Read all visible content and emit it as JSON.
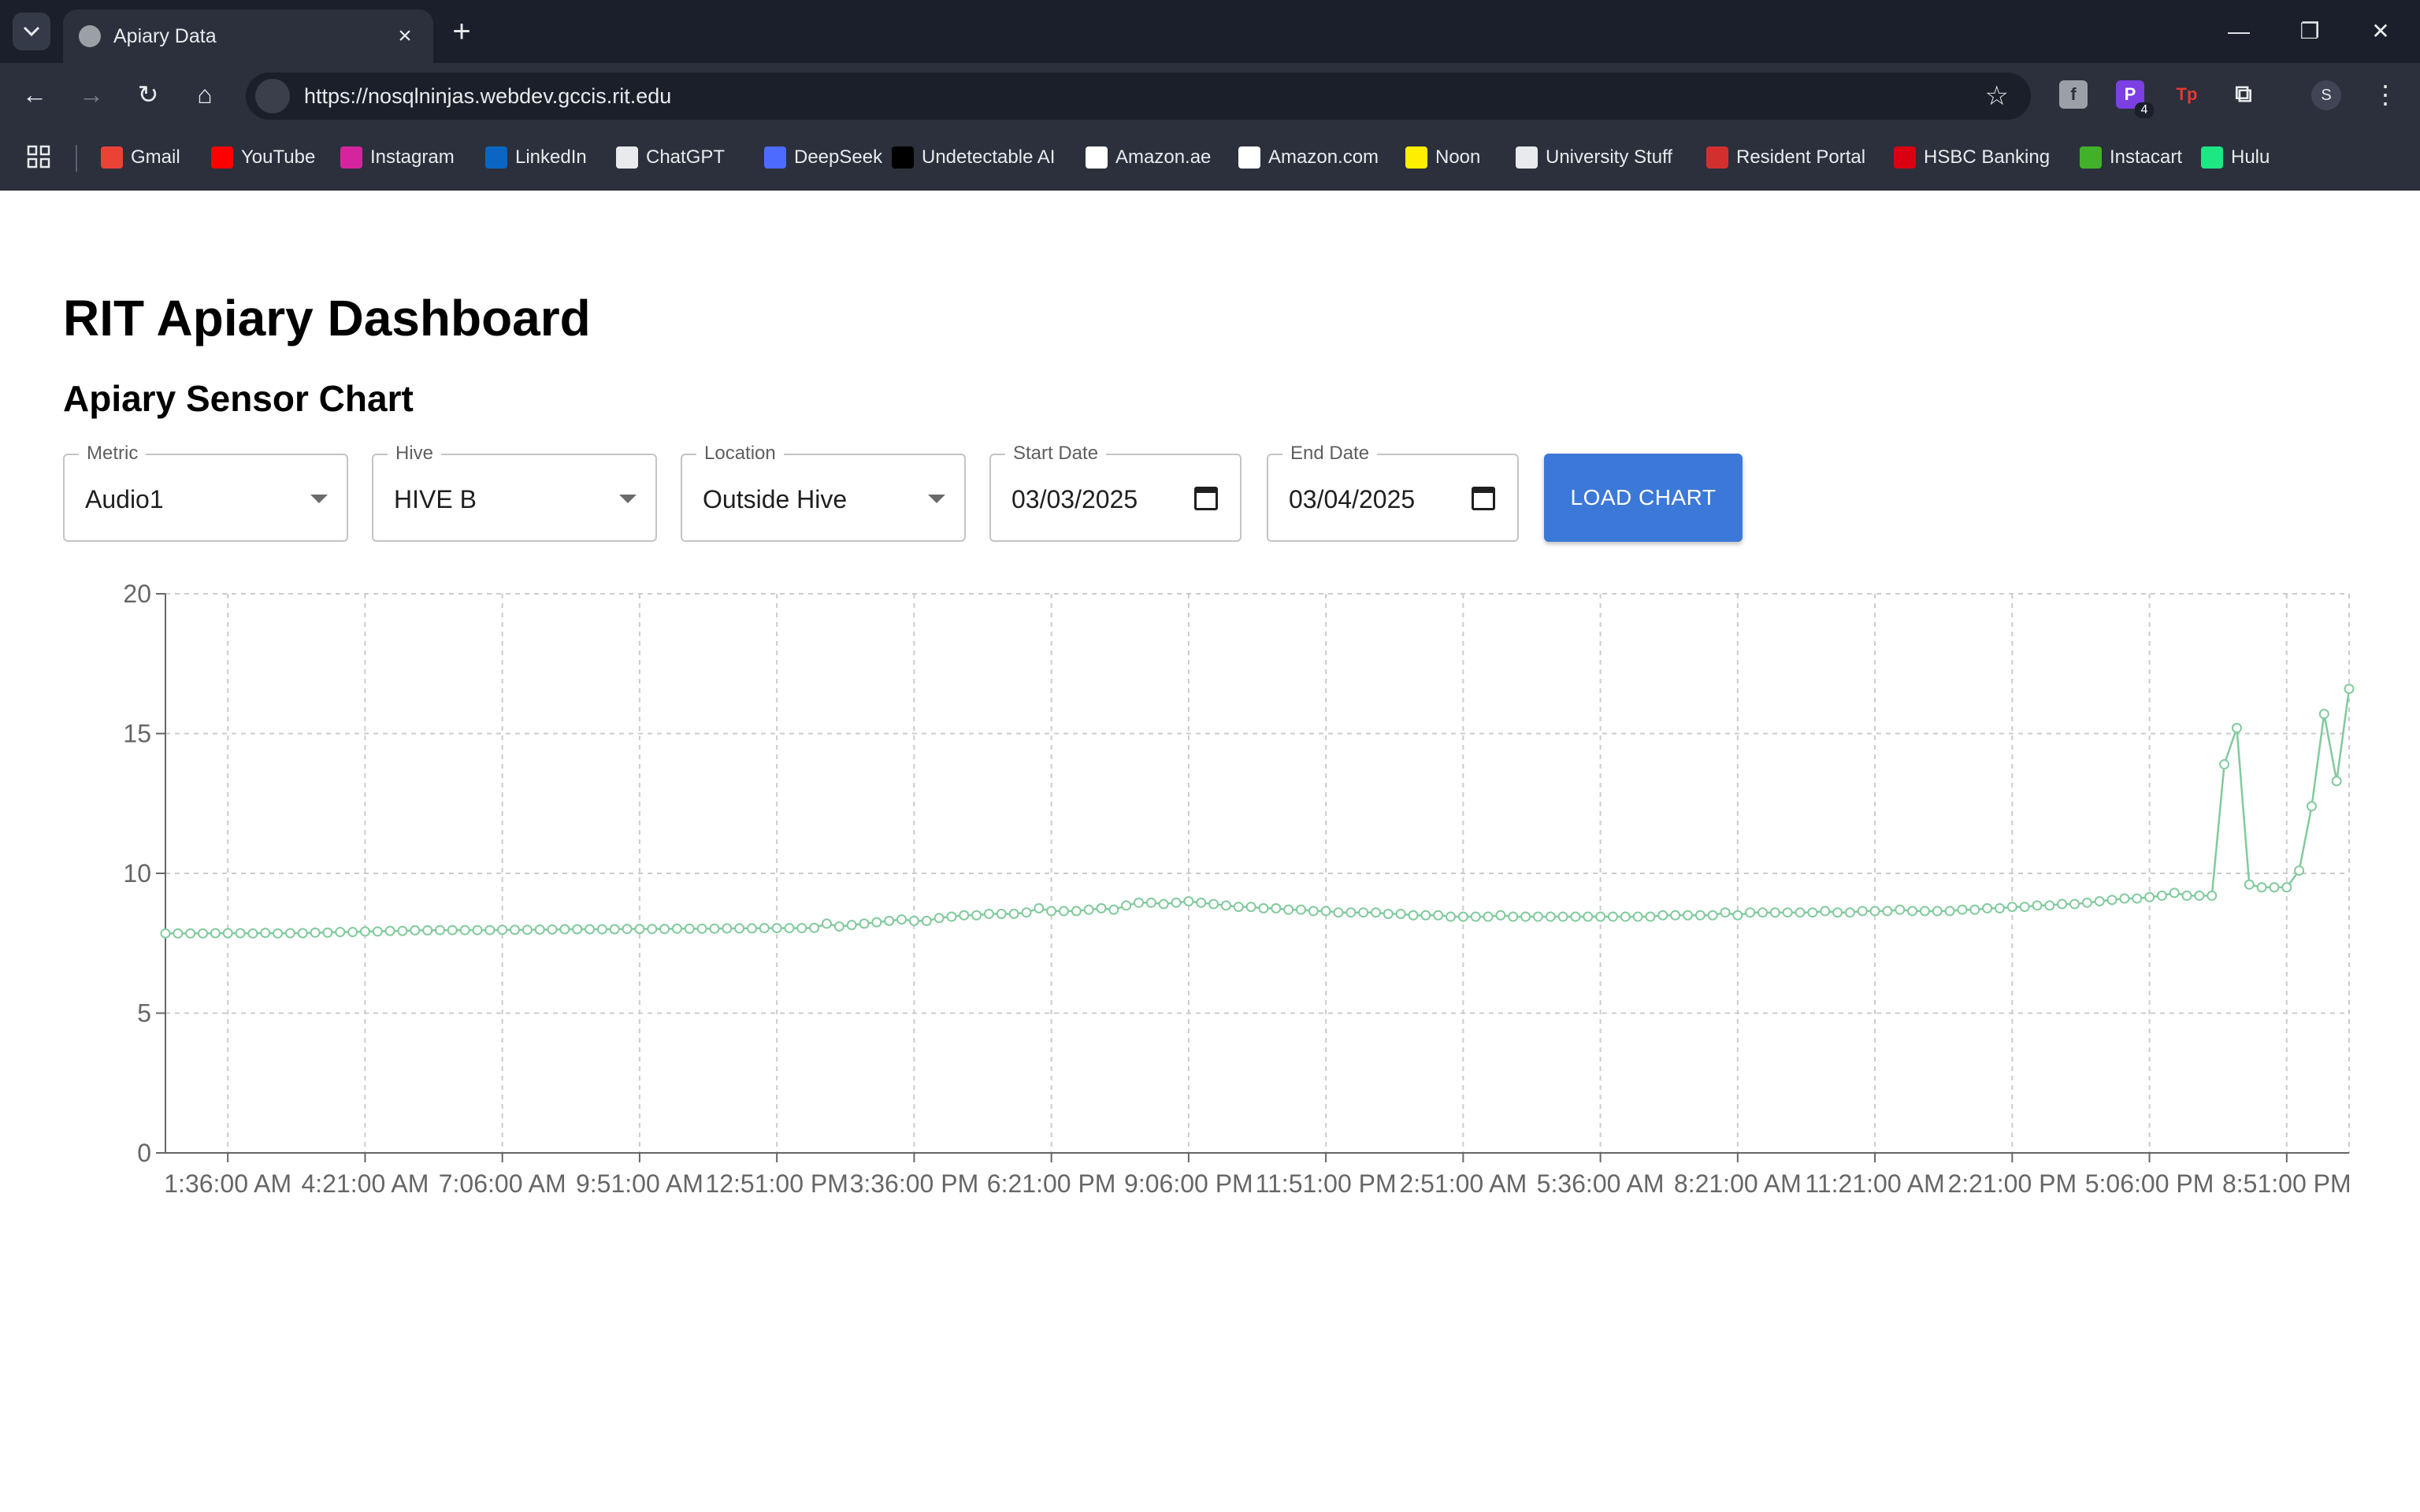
{
  "browser": {
    "tab_title": "Apiary Data",
    "url": "https://nosqlninjas.webdev.gccis.rit.edu",
    "extension_badge": "4",
    "profile_initial": "S",
    "bookmarks": [
      {
        "label": "Gmail",
        "icon": "gmail-icon",
        "color": "#ea4335"
      },
      {
        "label": "YouTube",
        "icon": "youtube-icon",
        "color": "#ff0000"
      },
      {
        "label": "Instagram",
        "icon": "instagram-icon",
        "color": "#d6249f"
      },
      {
        "label": "LinkedIn",
        "icon": "linkedin-icon",
        "color": "#0a66c2"
      },
      {
        "label": "ChatGPT",
        "icon": "chatgpt-icon",
        "color": "#e8eaed"
      },
      {
        "label": "DeepSeek",
        "icon": "deepseek-icon",
        "color": "#4d6bfe"
      },
      {
        "label": "Undetectable AI",
        "icon": "undetectable-icon",
        "color": "#000000"
      },
      {
        "label": "Amazon.ae",
        "icon": "amazon-icon",
        "color": "#ffffff"
      },
      {
        "label": "Amazon.com",
        "icon": "amazon-icon",
        "color": "#ffffff"
      },
      {
        "label": "Noon",
        "icon": "noon-icon",
        "color": "#feee00"
      },
      {
        "label": "University Stuff",
        "icon": "folder-icon",
        "color": "#e8eaed"
      },
      {
        "label": "Resident Portal",
        "icon": "resident-portal-icon",
        "color": "#d32f2f"
      },
      {
        "label": "HSBC Banking",
        "icon": "hsbc-icon",
        "color": "#db0011"
      },
      {
        "label": "Instacart",
        "icon": "instacart-icon",
        "color": "#43b02a"
      },
      {
        "label": "Hulu",
        "icon": "hulu-icon",
        "color": "#1ce783"
      }
    ]
  },
  "page": {
    "title": "RIT Apiary Dashboard",
    "subtitle": "Apiary Sensor Chart"
  },
  "filters": {
    "metric": {
      "label": "Metric",
      "value": "Audio1"
    },
    "hive": {
      "label": "Hive",
      "value": "HIVE B"
    },
    "location": {
      "label": "Location",
      "value": "Outside Hive"
    },
    "start_date": {
      "label": "Start Date",
      "value": "03/03/2025"
    },
    "end_date": {
      "label": "End Date",
      "value": "03/04/2025"
    },
    "load_button": "LOAD CHART"
  },
  "chart_data": {
    "type": "line",
    "title": "",
    "xlabel": "",
    "ylabel": "",
    "ylim": [
      0,
      20
    ],
    "yticks": [
      0,
      5,
      10,
      15,
      20
    ],
    "grid": true,
    "line_color": "#82ca9d",
    "xtick_labels": [
      "1:36:00 AM",
      "4:21:00 AM",
      "7:06:00 AM",
      "9:51:00 AM",
      "12:51:00 PM",
      "3:36:00 PM",
      "6:21:00 PM",
      "9:06:00 PM",
      "11:51:00 PM",
      "2:51:00 AM",
      "5:36:00 AM",
      "8:21:00 AM",
      "11:21:00 AM",
      "2:21:00 PM",
      "5:06:00 PM",
      "8:51:00 PM"
    ],
    "series": [
      {
        "values": [
          7.85,
          7.85,
          7.85,
          7.85,
          7.86,
          7.86,
          7.86,
          7.85,
          7.87,
          7.85,
          7.86,
          7.86,
          7.88,
          7.88,
          7.9,
          7.9,
          7.92,
          7.92,
          7.94,
          7.94,
          7.96,
          7.96,
          7.97,
          7.97,
          7.97,
          7.97,
          7.97,
          7.98,
          7.98,
          7.98,
          7.99,
          7.99,
          8,
          8,
          8,
          8,
          8,
          8.01,
          8.01,
          8.01,
          8.01,
          8.02,
          8.02,
          8.02,
          8.02,
          8.03,
          8.03,
          8.03,
          8.04,
          8.04,
          8.04,
          8.04,
          8.05,
          8.2,
          8.1,
          8.15,
          8.2,
          8.25,
          8.3,
          8.35,
          8.3,
          8.3,
          8.4,
          8.45,
          8.5,
          8.5,
          8.55,
          8.55,
          8.55,
          8.6,
          8.75,
          8.65,
          8.65,
          8.65,
          8.7,
          8.75,
          8.7,
          8.85,
          8.95,
          8.95,
          8.9,
          8.95,
          9,
          8.95,
          8.9,
          8.85,
          8.8,
          8.8,
          8.75,
          8.75,
          8.7,
          8.7,
          8.65,
          8.65,
          8.6,
          8.6,
          8.6,
          8.6,
          8.55,
          8.55,
          8.5,
          8.5,
          8.5,
          8.45,
          8.45,
          8.45,
          8.45,
          8.5,
          8.45,
          8.45,
          8.45,
          8.45,
          8.45,
          8.45,
          8.45,
          8.45,
          8.45,
          8.45,
          8.45,
          8.45,
          8.5,
          8.5,
          8.5,
          8.5,
          8.5,
          8.6,
          8.5,
          8.6,
          8.6,
          8.6,
          8.6,
          8.6,
          8.6,
          8.65,
          8.6,
          8.6,
          8.65,
          8.65,
          8.65,
          8.7,
          8.65,
          8.65,
          8.65,
          8.65,
          8.7,
          8.7,
          8.75,
          8.75,
          8.8,
          8.8,
          8.85,
          8.85,
          8.9,
          8.9,
          8.95,
          9,
          9.05,
          9.1,
          9.1,
          9.15,
          9.2,
          9.3,
          9.2,
          9.2,
          9.2,
          13.9,
          15.2,
          9.6,
          9.5,
          9.5,
          9.5,
          10.1,
          12.4,
          15.7,
          13.3,
          16.6
        ]
      }
    ]
  }
}
